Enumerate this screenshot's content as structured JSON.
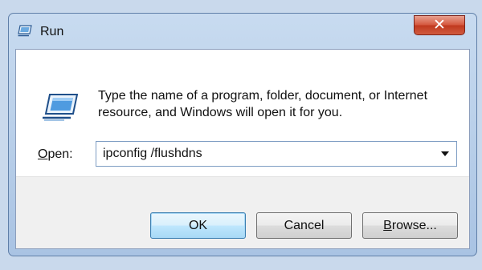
{
  "window": {
    "title": "Run",
    "close_glyph": "✕"
  },
  "dialog": {
    "description": "Type the name of a program, folder, document, or Internet resource, and Windows will open it for you.",
    "open_label_accel": "O",
    "open_label_rest": "pen:",
    "command_value": "ipconfig /flushdns"
  },
  "buttons": {
    "ok": "OK",
    "cancel": "Cancel",
    "browse_accel": "B",
    "browse_rest": "rowse..."
  },
  "colors": {
    "window_frame": "#b6cde8",
    "close_button": "#c9432a",
    "ok_button_border": "#3c7fb1"
  },
  "icons": [
    "run-app-icon",
    "run-program-icon",
    "close-icon",
    "dropdown-arrow-icon"
  ]
}
